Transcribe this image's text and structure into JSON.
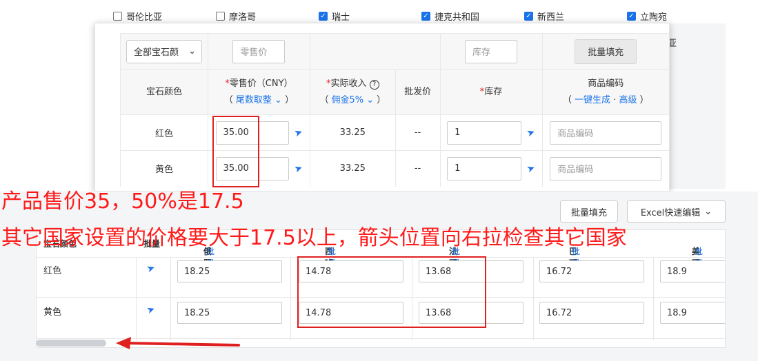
{
  "countries_row": [
    {
      "label": "哥伦比亚",
      "checked": false
    },
    {
      "label": "摩洛哥",
      "checked": false
    },
    {
      "label": "瑞士",
      "checked": true
    },
    {
      "label": "捷克共和国",
      "checked": true
    },
    {
      "label": "新西兰",
      "checked": true
    },
    {
      "label": "立陶宛",
      "checked": true
    }
  ],
  "stray_text": "亚",
  "panel": {
    "filter": {
      "color_select": "全部宝石颜",
      "retail_placeholder": "零售价",
      "stock_placeholder": "库存",
      "batch_fill": "批量填充"
    },
    "headers": {
      "color": "宝石颜色",
      "retail": "零售价（CNY）",
      "retail_sub": "尾数取整",
      "income": "实际收入",
      "income_sub": "佣金5%",
      "wholesale": "批发价",
      "stock": "库存",
      "sku": "商品编码",
      "sku_gen": "一键生成",
      "sku_adv": "高级",
      "required_mark": "*"
    },
    "rows": [
      {
        "color": "红色",
        "retail": "35.00",
        "income": "33.25",
        "wholesale": "--",
        "stock": "1",
        "sku_placeholder": "商品编码"
      },
      {
        "color": "黄色",
        "retail": "35.00",
        "income": "33.25",
        "wholesale": "--",
        "stock": "1",
        "sku_placeholder": "商品编码"
      }
    ]
  },
  "bottom": {
    "batch_fill": "批量填充",
    "excel_edit": "Excel快速编辑",
    "grid_headers": {
      "color": "宝石颜色",
      "batch": "批量",
      "c1": "俄罗斯",
      "c2": "西班牙",
      "c3": "法国",
      "c4": "巴西",
      "c5": "美国",
      "batch_link": "批量"
    },
    "rows": [
      {
        "color": "红色",
        "values": [
          "18.25",
          "14.78",
          "13.68",
          "16.72",
          "18.9"
        ]
      },
      {
        "color": "黄色",
        "values": [
          "18.25",
          "14.78",
          "13.68",
          "16.72",
          "18.9"
        ]
      }
    ]
  },
  "annotations": {
    "line1": "产品售价35，50%是17.5",
    "line2": "其它国家设置的价格要大于17.5以上，箭头位置向右拉检查其它国家"
  },
  "colors": {
    "accent": "#1a73e8",
    "annotation": "#ff1a1a"
  }
}
